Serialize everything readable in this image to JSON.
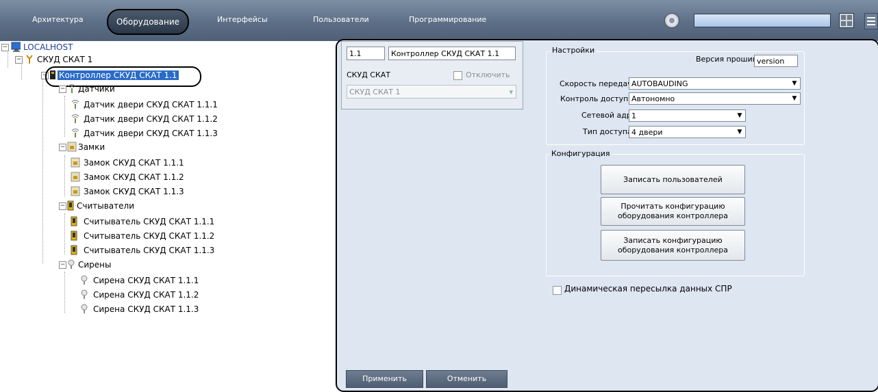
{
  "topbar": {
    "tabs": [
      "Архитектура",
      "Оборудование",
      "Интерфейсы",
      "Пользователи",
      "Программирование"
    ],
    "active_tab": "Оборудование"
  },
  "tree": {
    "root": "LOCALHOST",
    "device": "СКУД СКАТ 1",
    "controller": "Контроллер СКУД СКАТ 1.1",
    "groups": [
      {
        "label": "Датчики",
        "items": [
          "Датчик двери СКУД СКАТ 1.1.1",
          "Датчик двери СКУД СКАТ 1.1.2",
          "Датчик двери СКУД СКАТ 1.1.3"
        ]
      },
      {
        "label": "Замки",
        "items": [
          "Замок СКУД СКАТ 1.1.1",
          "Замок СКУД СКАТ 1.1.2",
          "Замок СКУД СКАТ 1.1.3"
        ]
      },
      {
        "label": "Считыватели",
        "items": [
          "Считыватель СКУД СКАТ 1.1.1",
          "Считыватель СКУД СКАТ 1.1.2",
          "Считыватель СКУД СКАТ 1.1.3"
        ]
      },
      {
        "label": "Сирены",
        "items": [
          "Сирена СКУД СКАТ 1.1.1",
          "Сирена СКУД СКАТ 1.1.2",
          "Сирена СКУД СКАТ 1.1.3"
        ]
      }
    ]
  },
  "card": {
    "id_value": "1.1",
    "name_value": "Контроллер СКУД СКАТ 1.1",
    "type_label": "СКУД СКАТ",
    "disable_label": "Отключить",
    "parent_value": "СКУД СКАТ 1"
  },
  "settings": {
    "title": "Настройки",
    "firmware_label": "Версия прошивки:",
    "firmware_value": "version",
    "baud_label": "Скорость передачи:",
    "baud_value": "AUTOBAUDING",
    "access_control_label": "Контроль доступа:",
    "access_control_value": "Автономно",
    "net_address_label": "Сетевой адрес:",
    "net_address_value": "1",
    "access_type_label": "Тип доступа:",
    "access_type_value": "4 двери"
  },
  "config": {
    "title": "Конфигурация",
    "write_users": "Записать пользователей",
    "read_config_1": "Прочитать конфигурацию",
    "read_config_2": "оборудования контроллера",
    "write_config_1": "Записать  конфигурацию",
    "write_config_2": "оборудования контроллера"
  },
  "dynamic_label": "Динамическая пересылка данных СПР",
  "footer": {
    "apply": "Применить",
    "cancel": "Отменить"
  }
}
